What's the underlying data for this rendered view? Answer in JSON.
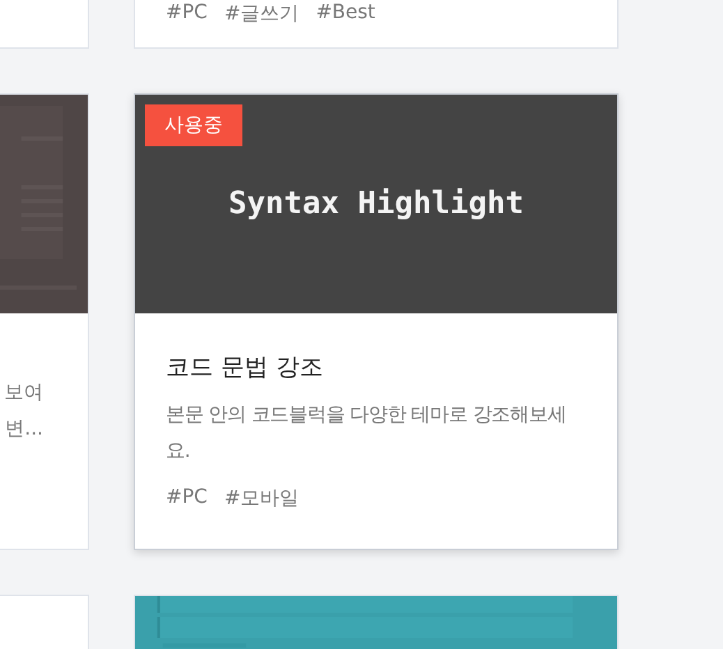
{
  "cards": [
    {
      "kind": "blank"
    },
    {
      "kind": "content",
      "tags": [
        "#PC",
        "#글쓰기",
        "#Best"
      ]
    },
    {
      "kind": "content",
      "image": {
        "kind": "picture"
      },
      "description_lines": [
        "보여",
        "변..."
      ]
    },
    {
      "image": {
        "kind": "banner",
        "text": "Syntax Highlight"
      },
      "badge": "사용중",
      "title": "코드 문법 강조",
      "description": "본문 안의 코드블럭을 다양한 테마로 강조해보세요.",
      "tags": [
        "#PC",
        "#모바일"
      ],
      "raised": true,
      "kind": "content"
    },
    {
      "kind": "blank"
    },
    {
      "kind": "content",
      "image": {
        "kind": "picture"
      }
    }
  ]
}
